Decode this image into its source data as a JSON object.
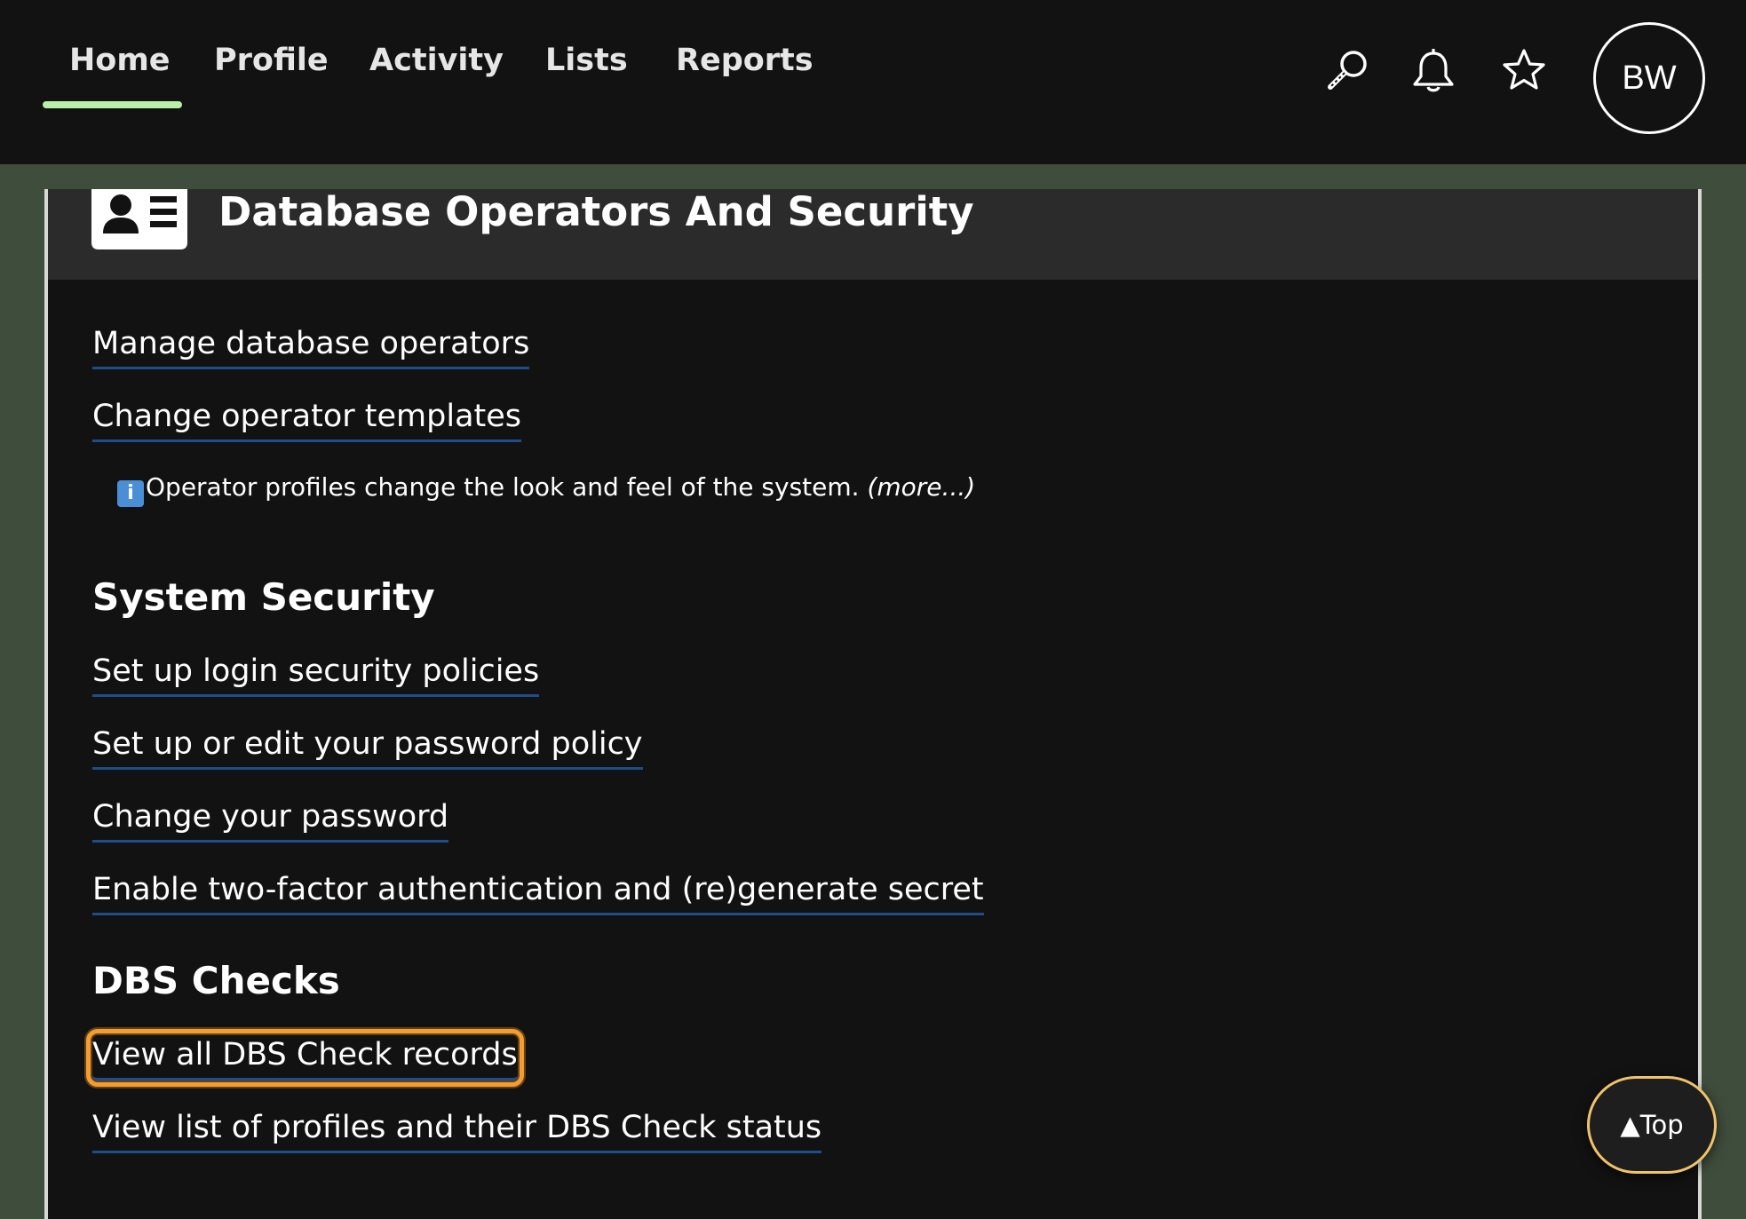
{
  "colors": {
    "page_background": "#3f4d3c",
    "topbar_background": "#121212",
    "panel_background": "#121212",
    "panel_header_background": "#2b2b2b",
    "active_tab_underline": "#b8f0a8",
    "link_underline": "#1f4d8a",
    "focus_ring": "#f39c2f",
    "top_button_border": "#f0c36a"
  },
  "nav": {
    "tabs": [
      {
        "label": "Home",
        "active": true
      },
      {
        "label": "Profile",
        "active": false
      },
      {
        "label": "Activity",
        "active": false
      },
      {
        "label": "Lists",
        "active": false
      },
      {
        "label": "Reports",
        "active": false
      }
    ],
    "icons": [
      "search-icon",
      "bell-icon",
      "star-icon"
    ],
    "avatar_initials": "BW"
  },
  "panel": {
    "title": "Database Operators And Security",
    "header_icon": "contact-card-icon",
    "operator_links": [
      "Manage database operators",
      "Change operator templates"
    ],
    "info_text": "Operator profiles change the look and feel of the system.",
    "info_more": "(more...)",
    "sections": [
      {
        "heading": "System Security",
        "links": [
          "Set up login security policies",
          "Set up or edit your password policy",
          "Change your password",
          "Enable two-factor authentication and (re)generate secret"
        ]
      },
      {
        "heading": "DBS Checks",
        "links": [
          "View all DBS Check records",
          "View list of profiles and their DBS Check status"
        ],
        "focused_link": "View all DBS Check records"
      }
    ]
  },
  "top_button": {
    "arrow": "▲",
    "label": "Top"
  }
}
